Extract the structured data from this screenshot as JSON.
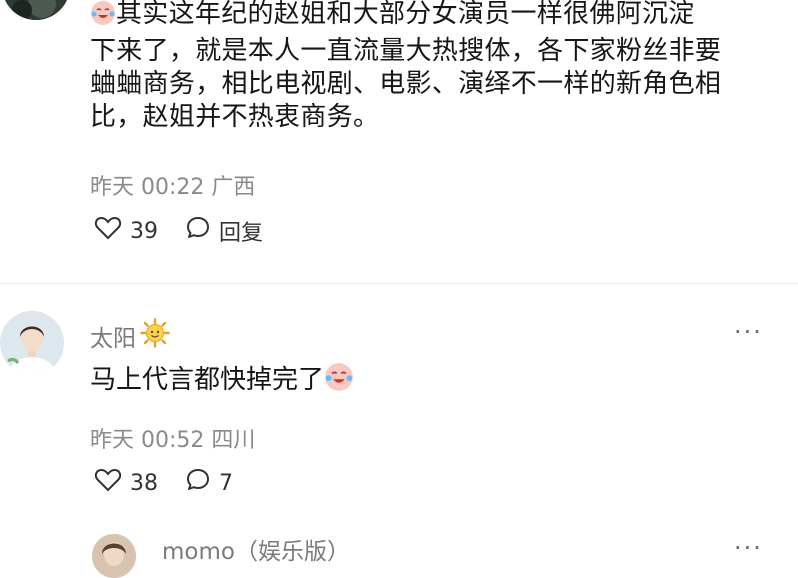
{
  "comments": [
    {
      "text_lines": [
        "其实这年纪的赵姐和大部分女演员一样很佛阿沉淀",
        "下来了，就是本人一直流量大热搜体，各下家粉丝非要",
        "蛐蛐商务，相比电视剧、电影、演绎不一样的新角色相",
        "比，赵姐并不热衷商务。"
      ],
      "time": "昨天 00:22",
      "location": "广西",
      "likes": "39",
      "reply_label": "回复",
      "leading_emoji": "laughing-crying-emoji"
    },
    {
      "username": "太阳",
      "username_emoji": "sun-emoji",
      "text": "马上代言都快掉完了",
      "trailing_emoji": "laughing-crying-emoji",
      "time": "昨天 00:52",
      "location": "四川",
      "likes": "38",
      "replies": "7",
      "more": "···"
    },
    {
      "username": "momo（娱乐版）",
      "more": "···"
    }
  ],
  "colors": {
    "text": "#161616",
    "meta": "#8a8a8a",
    "icon": "#333333"
  }
}
